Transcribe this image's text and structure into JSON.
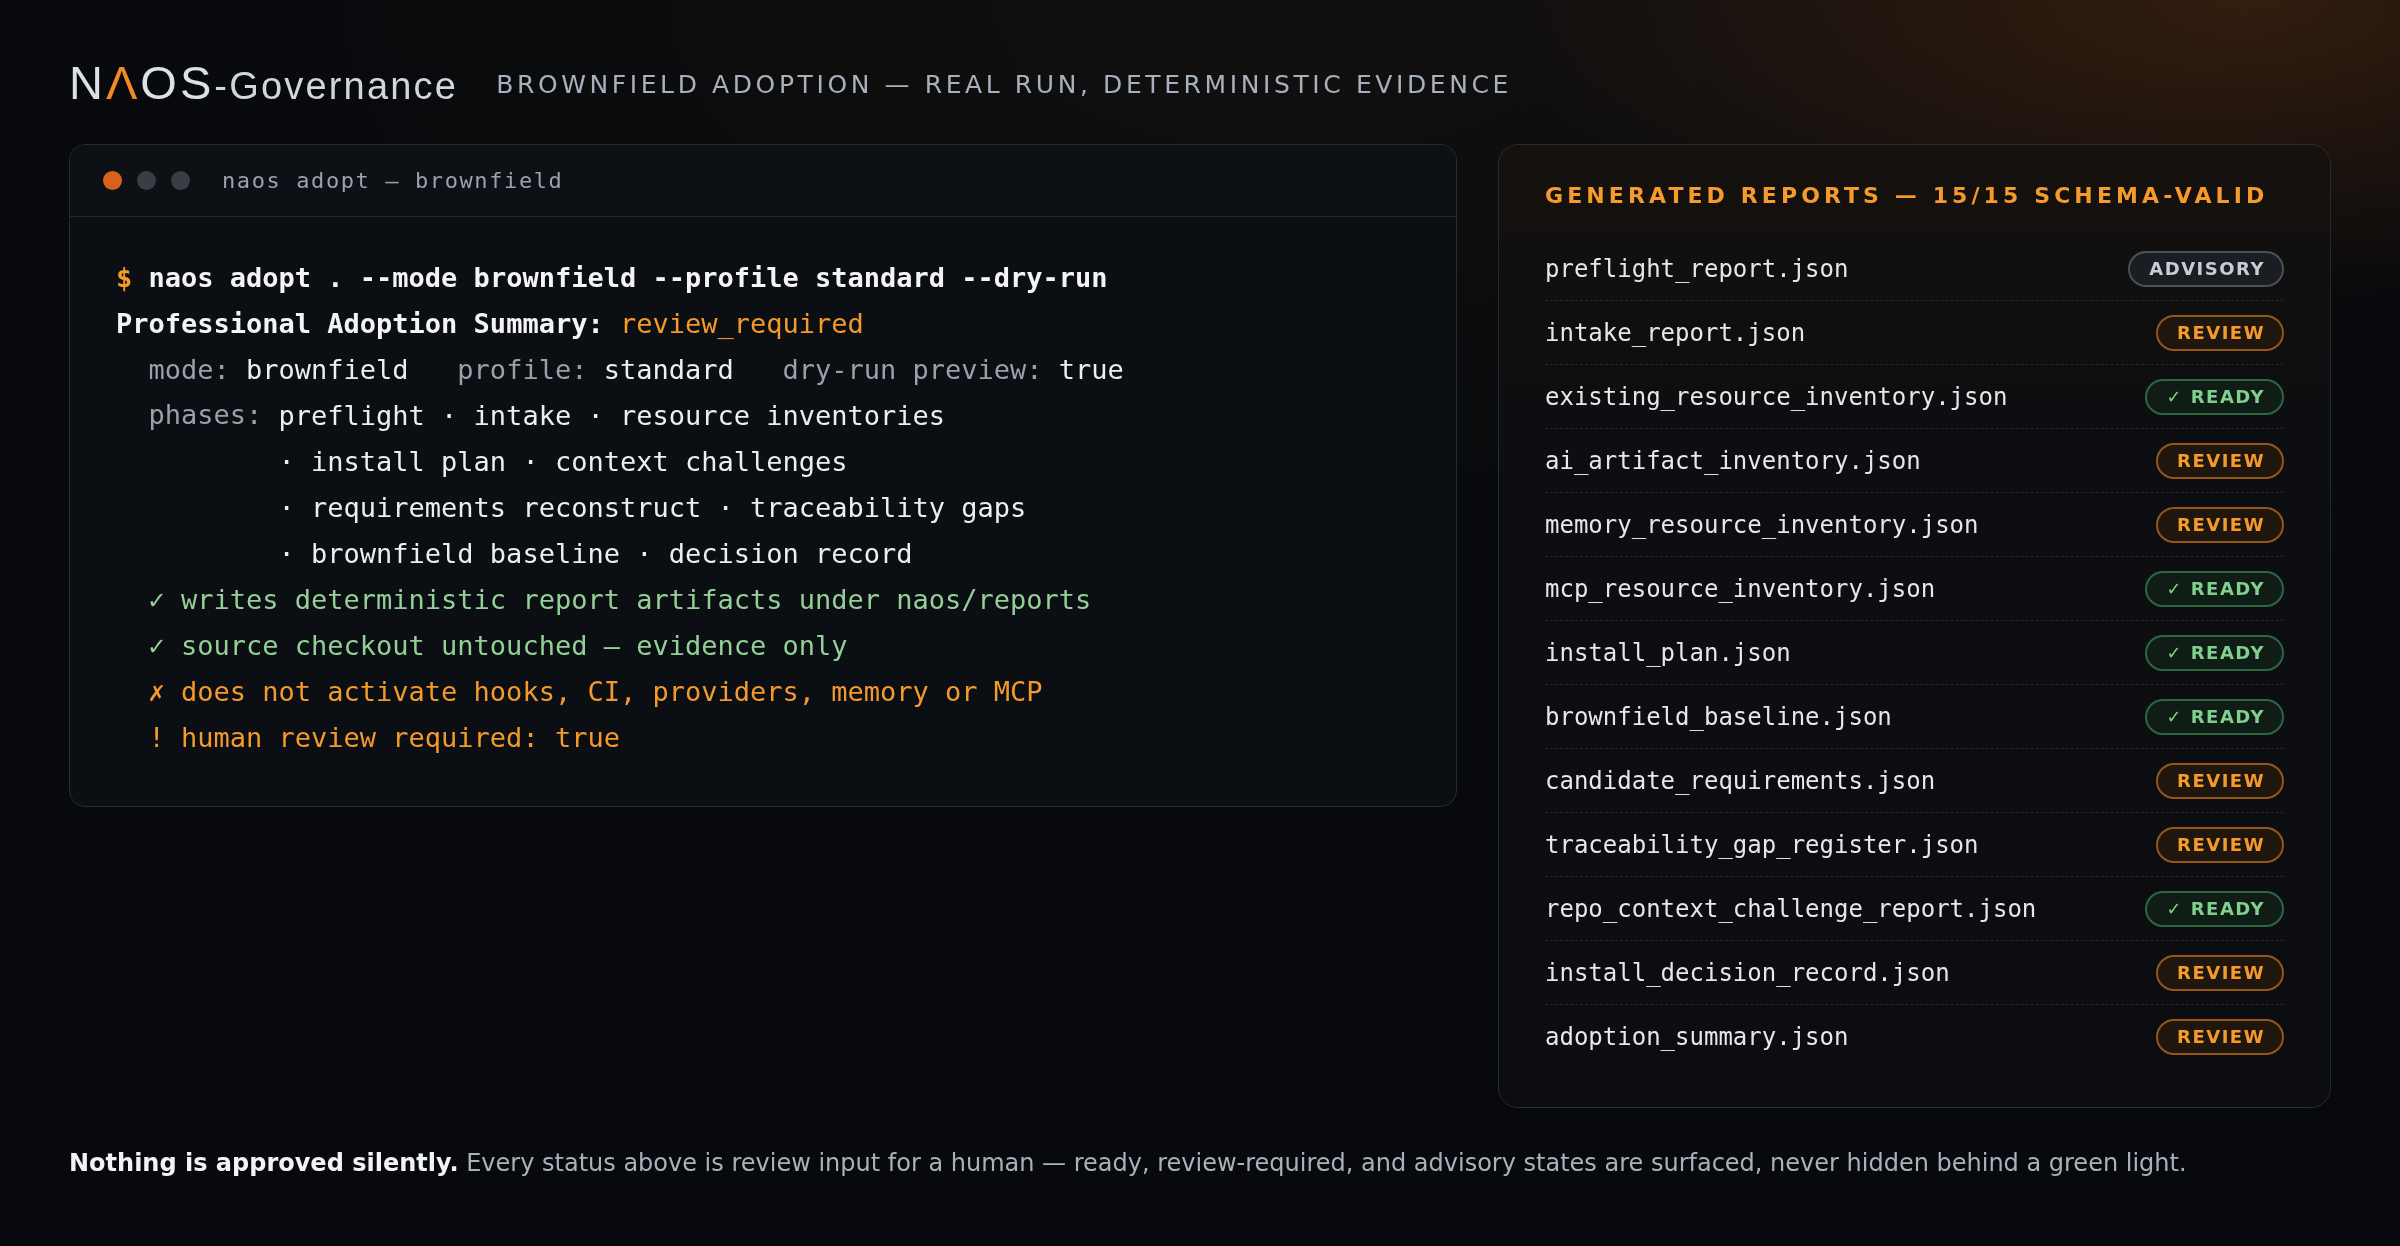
{
  "header": {
    "logo": [
      {
        "text": "N",
        "kind": "letter"
      },
      {
        "text": "Λ",
        "kind": "accent"
      },
      {
        "text": "OS",
        "kind": "letter"
      },
      {
        "text": "-Governance",
        "kind": "suffix"
      }
    ],
    "subtitle": "BROWNFIELD ADOPTION — REAL RUN, DETERMINISTIC EVIDENCE"
  },
  "terminal": {
    "window_controls": [
      {
        "color": "#d9611c"
      },
      {
        "color": "#3a3d43"
      },
      {
        "color": "#3a3d43"
      }
    ],
    "title": "naos adopt — brownfield",
    "command": {
      "prompt": "$",
      "text": "naos adopt . --mode brownfield --profile standard --dry-run"
    },
    "summary": {
      "label": "Professional Adoption Summary:",
      "value": "review_required"
    },
    "settings": [
      {
        "key": "mode:",
        "value": "brownfield"
      },
      {
        "key": "profile:",
        "value": "standard"
      },
      {
        "key": "dry-run preview:",
        "value": "true"
      }
    ],
    "phases": {
      "label": "phases:",
      "lines": [
        "preflight · intake · resource inventories",
        "· install plan · context challenges",
        "· requirements reconstruct · traceability gaps",
        "· brownfield baseline · decision record"
      ]
    },
    "checks": [
      {
        "kind": "pass",
        "mark": "✓",
        "text": "writes deterministic report artifacts under naos/reports"
      },
      {
        "kind": "pass",
        "mark": "✓",
        "text": "source checkout untouched — evidence only"
      },
      {
        "kind": "fail",
        "mark": "✗",
        "text": "does not activate hooks, CI, providers, memory or MCP"
      },
      {
        "kind": "warn",
        "mark": "!",
        "text": "human review required: true"
      }
    ]
  },
  "reports": {
    "title": "GENERATED REPORTS — 15/15 SCHEMA-VALID",
    "rows": [
      {
        "file": "preflight_report.json",
        "kind": "advisory",
        "badge": "ADVISORY"
      },
      {
        "file": "intake_report.json",
        "kind": "review",
        "badge": "REVIEW"
      },
      {
        "file": "existing_resource_inventory.json",
        "kind": "ready",
        "badge": "✓ READY"
      },
      {
        "file": "ai_artifact_inventory.json",
        "kind": "review",
        "badge": "REVIEW"
      },
      {
        "file": "memory_resource_inventory.json",
        "kind": "review",
        "badge": "REVIEW"
      },
      {
        "file": "mcp_resource_inventory.json",
        "kind": "ready",
        "badge": "✓ READY"
      },
      {
        "file": "install_plan.json",
        "kind": "ready",
        "badge": "✓ READY"
      },
      {
        "file": "brownfield_baseline.json",
        "kind": "ready",
        "badge": "✓ READY"
      },
      {
        "file": "candidate_requirements.json",
        "kind": "review",
        "badge": "REVIEW"
      },
      {
        "file": "traceability_gap_register.json",
        "kind": "review",
        "badge": "REVIEW"
      },
      {
        "file": "repo_context_challenge_report.json",
        "kind": "ready",
        "badge": "✓ READY"
      },
      {
        "file": "install_decision_record.json",
        "kind": "review",
        "badge": "REVIEW"
      },
      {
        "file": "adoption_summary.json",
        "kind": "review",
        "badge": "REVIEW"
      }
    ]
  },
  "footer": {
    "note": "**Nothing is approved silently.** Every status above is review input for a human — ready, review-required, and advisory states are surfaced, never hidden behind a green light."
  }
}
